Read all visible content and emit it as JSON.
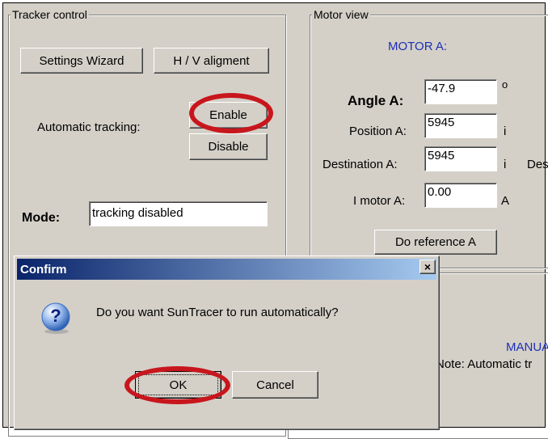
{
  "tracker": {
    "legend": "Tracker control",
    "settings_wizard": "Settings Wizard",
    "hv_alignment": "H / V aligment",
    "automatic_tracking_label": "Automatic tracking:",
    "enable": "Enable",
    "disable": "Disable",
    "mode_label": "Mode:",
    "mode_value": "tracking disabled"
  },
  "motor": {
    "legend": "Motor view",
    "heading": "MOTOR A:",
    "angle_label": "Angle A:",
    "angle_value": "-47.9",
    "angle_unit": "o",
    "position_label": "Position A:",
    "position_value": "5945",
    "position_unit": "i",
    "destination_label": "Destination A:",
    "destination_value": "5945",
    "destination_unit": "i",
    "destination_cut": "Des",
    "current_label": "I motor A:",
    "current_value": "0.00",
    "current_unit": "A",
    "reference_button": "Do reference A",
    "manual_text": "MANUA",
    "note_text": "Note: Automatic tr"
  },
  "dialog": {
    "title": "Confirm",
    "close": "×",
    "icon_glyph": "?",
    "message": "Do you want SunTracer to run automatically?",
    "ok": "OK",
    "cancel": "Cancel"
  },
  "colors": {
    "panel": "#d4d0c8",
    "accent_blue": "#1c2fb6",
    "annotation_red": "#c8161d",
    "title_gradient_start": "#0a246a",
    "title_gradient_end": "#a6caf0"
  }
}
